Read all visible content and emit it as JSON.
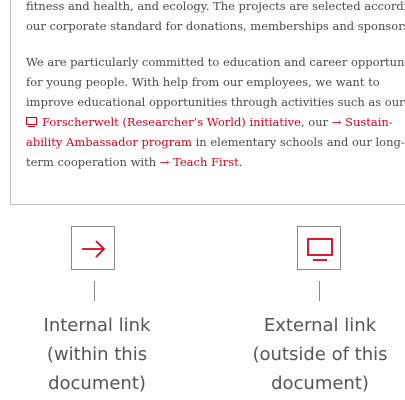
{
  "document": {
    "lines": [
      "fitness and health, and ecology. The projects are selected according to",
      "our corporate standard for donations, memberships and sponsorships.",
      "We are particularly committed to education and career opportunities",
      "for young people. With help from our employees, we want to",
      "improve educational opportunities through activities such as our"
    ],
    "line6_link": "Forscherwelt (Researcher’s World) initiative",
    "line6_mid": ", our",
    "line6_link2": "Sustain-",
    "line7_link": "ability Ambassador program",
    "line7_rest": " in elementary schools and our long-",
    "line8_start": "term cooperation with",
    "line8_link": "Teach First",
    "line8_end": "."
  },
  "legend": {
    "internal": {
      "line1": "Internal link",
      "line2": "(within this",
      "line3": "document)"
    },
    "external": {
      "line1": "External link",
      "line2": "(outside of this",
      "line3": "document)"
    }
  },
  "colors": {
    "link": "#d9001b",
    "text": "#4a4a4a",
    "legend_text": "#555555",
    "border": "#8a8a8a"
  }
}
